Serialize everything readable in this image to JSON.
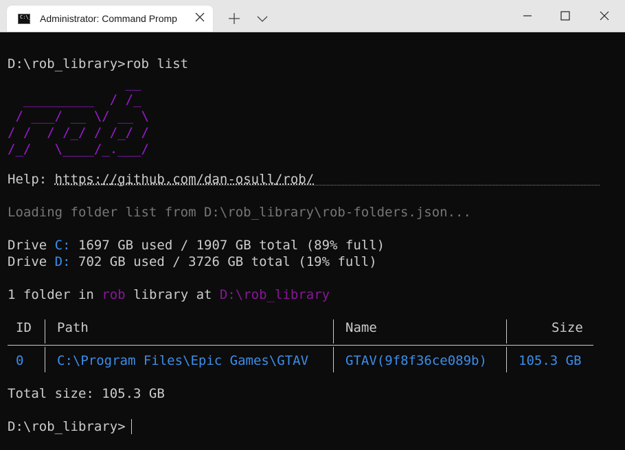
{
  "window": {
    "tab_title": "Administrator: Command Promp",
    "tab_icon_text": "C:\\_"
  },
  "terminal": {
    "cmd_line": {
      "prompt": "D:\\rob_library>",
      "command": "rob list"
    },
    "logo": "               __\n  _________  / /_\n / ___/ __ \\/ __ \\\n/ /  / /_/ / /_/ /\n/_/   \\____/_.___/",
    "help": {
      "label": "Help:",
      "url": "https://github.com/dan-osull/rob/"
    },
    "loading": "Loading folder list from D:\\rob_library\\rob-folders.json...",
    "drives": [
      {
        "prefix": "Drive",
        "letter": "C:",
        "info": "1697 GB used / 1907 GB total (89% full)"
      },
      {
        "prefix": "Drive",
        "letter": "D:",
        "info": "702 GB used / 3726 GB total (19% full)"
      }
    ],
    "summary": {
      "part1": "1 folder in",
      "rob": "rob",
      "part2": "library at",
      "path": "D:\\rob_library"
    },
    "table": {
      "headers": {
        "id": "ID",
        "path": "Path",
        "name": "Name",
        "size": "Size"
      },
      "rows": [
        {
          "id": "0",
          "path": "C:\\Program Files\\Epic Games\\GTAV",
          "name": "GTAV(9f8f36ce089b)",
          "size": "105.3 GB"
        }
      ]
    },
    "total": "Total size: 105.3 GB",
    "final_prompt": "D:\\rob_library>"
  },
  "colors": {
    "purple": "#881798",
    "blue": "#3b8eea",
    "grey": "#767676",
    "text": "#cccccc",
    "background": "#0c0c0c"
  }
}
